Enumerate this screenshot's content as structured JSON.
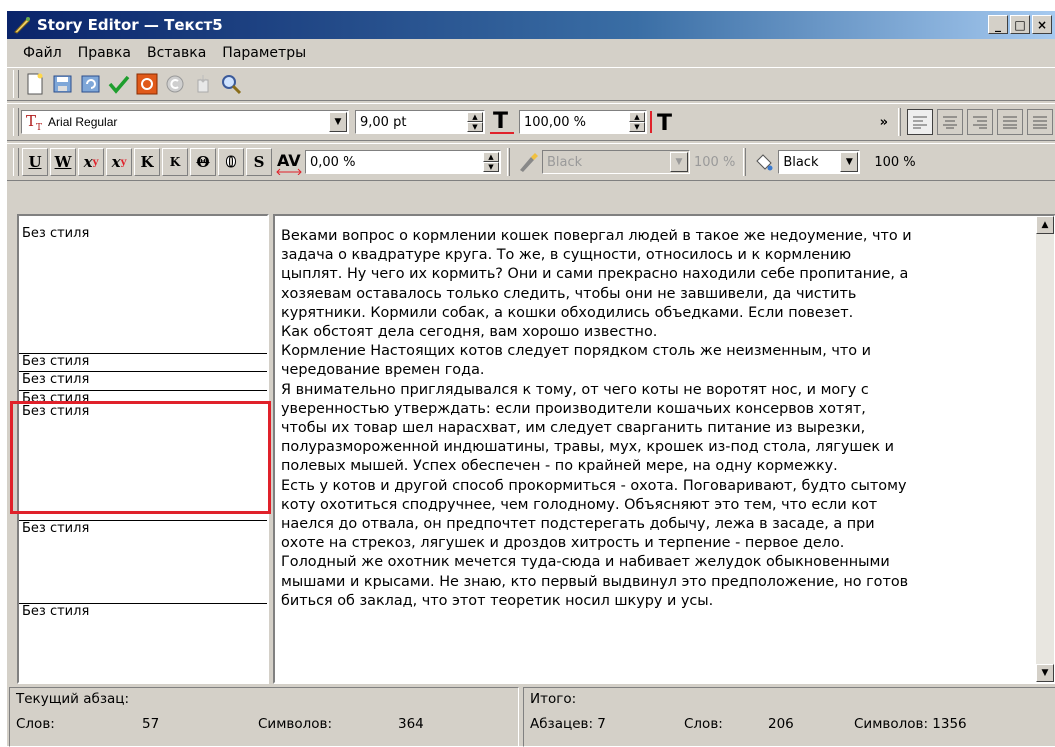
{
  "window": {
    "title": "Story Editor — Текст5"
  },
  "menu": [
    {
      "label": "Файл"
    },
    {
      "label": "Правка"
    },
    {
      "label": "Вставка"
    },
    {
      "label": "Параметры"
    }
  ],
  "format_toolbar": {
    "font": "Arial Regular",
    "size": "9,00 pt",
    "scale": "100,00 %",
    "tracking": "0,00 %",
    "fill_color": "Black",
    "fill_tint": "100 %",
    "stroke_color": "Black",
    "stroke_tint": "100 %",
    "more": "»"
  },
  "styles": [
    {
      "label": "Без стиля"
    },
    {
      "label": "Без стиля"
    },
    {
      "label": "Без стиля"
    },
    {
      "label": "Без стиля"
    },
    {
      "label": "Без стиля"
    },
    {
      "label": "Без стиля"
    },
    {
      "label": "Без стиля"
    }
  ],
  "story_text": "Веками вопрос о кормлении кошек повергал людей в такое же недоумение, что и\nзадача о квадратуре круга. То же, в сущности, относилось и к кормлению\nцыплят. Ну чего их кормить? Они и сами прекрасно находили себе пропитание, а\nхозяевам оставалось только следить, чтобы они не завшивели, да чистить\nкурятники. Кормили собак, а кошки обходились объедками. Если повезет.\nКак обстоят дела сегодня, вам хорошо известно.\nКормление Настоящих котов следует порядком столь же неизменным, что и\nчередование времен года.\nЯ внимательно приглядывался к тому, от чего коты не воротят нос, и могу с\nуверенностью утверждать: если производители кошачьих консервов хотят,\nчтобы их товар шел нарасхват, им следует сварганить питание из вырезки,\nполуразмороженной индюшатины, травы, мух, крошек из-под стола, лягушек и\nполевых мышей. Успех обеспечен - по крайней мере, на одну кормежку.\nЕсть у котов и другой способ прокормиться - охота. Поговаривают, будто сытому\nкоту охотиться сподручнее, чем голодному. Объясняют это тем, что если кот\nнаелся до отвала, он предпочтет подстерегать добычу, лежа в засаде, а при\nохоте на стрекоз, лягушек и дроздов хитрость и терпение - первое дело.\nГолодный же охотник мечется туда-сюда и набивает желудок обыкновенными\nмышами и крысами. Не знаю, кто первый выдвинул это предположение, но готов\nбиться об заклад, что этот теоретик носил шкуру и усы.",
  "status": {
    "current_label": "Текущий абзац:",
    "words_label": "Слов:",
    "words_value": "57",
    "chars_label": "Символов:",
    "chars_value": "364",
    "total_label": "Итого:",
    "paragraphs": "Абзацев: 7",
    "total_words_label": "Слов:",
    "total_words_value": "206",
    "total_chars": "Символов: 1356"
  },
  "colors": {
    "highlight": "#e0212a",
    "titlebar": "#0a246a",
    "chrome": "#d4d0c8"
  }
}
